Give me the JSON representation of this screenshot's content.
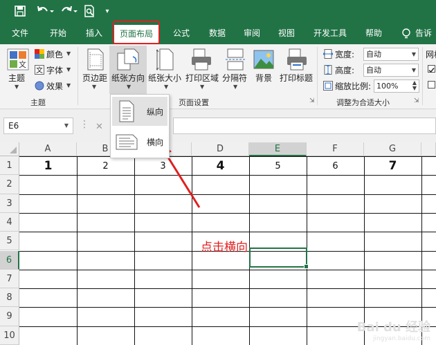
{
  "quick_access": {
    "more_label": "▾"
  },
  "tabs": [
    {
      "label": "文件"
    },
    {
      "label": "开始"
    },
    {
      "label": "插入"
    },
    {
      "label": "页面布局"
    },
    {
      "label": "公式"
    },
    {
      "label": "数据"
    },
    {
      "label": "审阅"
    },
    {
      "label": "视图"
    },
    {
      "label": "开发工具"
    },
    {
      "label": "帮助"
    },
    {
      "label": "告诉"
    }
  ],
  "ribbon": {
    "theme_group": {
      "theme_label": "主题",
      "colors_label": "颜色",
      "fonts_label": "字体",
      "effects_label": "效果",
      "group_label": "主题"
    },
    "page_setup_group": {
      "margins_label": "页边距",
      "orientation_label": "纸张方向",
      "size_label": "纸张大小",
      "print_area_label": "打印区域",
      "breaks_label": "分隔符",
      "background_label": "背景",
      "print_titles_label": "打印标题",
      "group_label": "页面设置"
    },
    "scale_group": {
      "width_label": "宽度:",
      "width_value": "自动",
      "height_label": "高度:",
      "height_value": "自动",
      "scale_label": "缩放比例:",
      "scale_value": "100%",
      "group_label": "调整为合适大小"
    },
    "sheet_options_group": {
      "gridlines_label": "网格"
    }
  },
  "formula_bar": {
    "name_box": "E6"
  },
  "orientation_menu": {
    "portrait_label": "纵向",
    "landscape_label": "横向"
  },
  "sheet": {
    "columns": [
      "A",
      "B",
      "C",
      "D",
      "E",
      "F",
      "G"
    ],
    "selected_column": "E",
    "rows": [
      "1",
      "2",
      "3",
      "4",
      "5",
      "6",
      "7",
      "8",
      "9",
      "10"
    ],
    "selected_row": "6",
    "row1_values": [
      "1",
      "2",
      "3",
      "4",
      "5",
      "6",
      "7"
    ]
  },
  "annotation": {
    "text": "点击横向"
  },
  "watermark": {
    "text": "Bai du 经验",
    "sub": "jingyan.baidu.com"
  }
}
